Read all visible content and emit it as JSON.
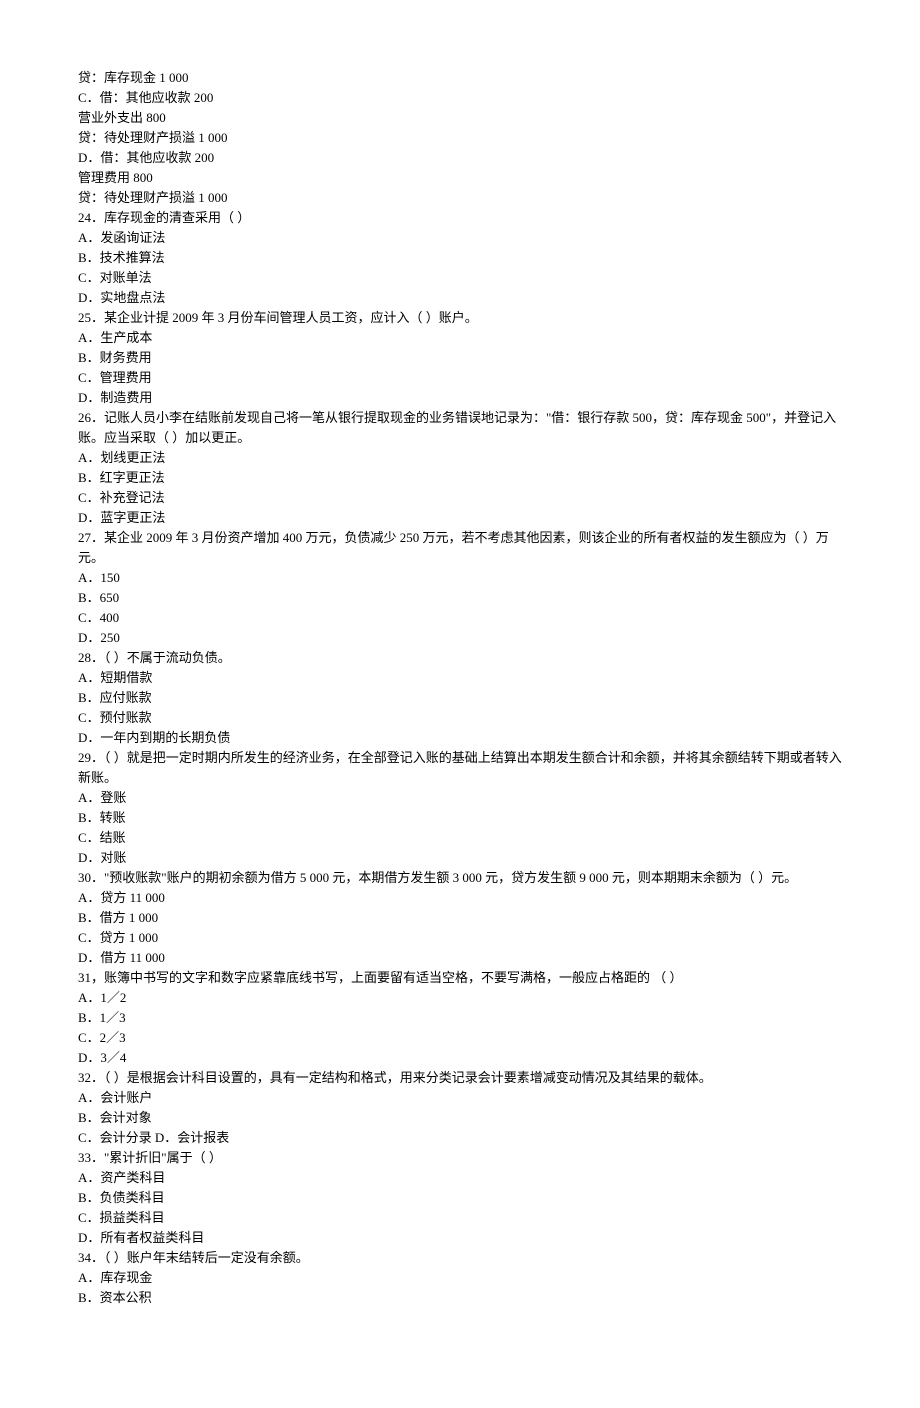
{
  "lines": [
    "贷：库存现金  1 000",
    "C．借：其他应收款  200",
    "营业外支出  800",
    "贷：待处理财产损溢  1 000",
    "D．借：其他应收款  200",
    "管理费用  800",
    "贷：待处理财产损溢  1 000",
    "24．库存现金的清查采用（    ）",
    "A．发函询证法",
    "B．技术推算法",
    "C．对账单法",
    "D．实地盘点法",
    "25．某企业计提 2009 年 3 月份车间管理人员工资，应计入（    ）账户。",
    "A．生产成本",
    "B．财务费用",
    "C．管理费用",
    "D．制造费用",
    "26．记账人员小李在结账前发现自己将一笔从银行提取现金的业务错误地记录为：\"借：银行存款 500，贷：库存现金 500\"，并登记入账。应当采取（    ）加以更正。",
    "A．划线更正法",
    "B．红字更正法",
    "C．补充登记法",
    "D．蓝字更正法",
    "27．某企业 2009 年 3 月份资产增加 400 万元，负债减少 250 万元，若不考虑其他因素，则该企业的所有者权益的发生额应为（    ）万元。",
    "A．150",
    "B．650",
    "C．400",
    "D．250",
    "28．（    ）不属于流动负债。",
    "A．短期借款",
    "B．应付账款",
    "C．预付账款",
    "D．一年内到期的长期负债",
    "29．（    ）就是把一定时期内所发生的经济业务，在全部登记入账的基础上结算出本期发生额合计和余额，并将其余额结转下期或者转入新账。",
    "A．登账",
    "B．转账",
    "C．结账",
    "D．对账",
    "30．\"预收账款\"账户的期初余额为借方 5 000 元，本期借方发生额 3 000 元，贷方发生额 9 000 元，则本期期末余额为（    ）元。",
    "A．贷方 11 000",
    "B．借方 1 000",
    "C．贷方 1 000",
    "D．借方 11 000",
    "31，账簿中书写的文字和数字应紧靠底线书写，上面要留有适当空格，不要写满格，一般应占格距的 （    ）",
    "A．1／2",
    "B．1／3",
    "C．2／3",
    "D．3／4",
    "32．（    ）是根据会计科目设置的，具有一定结构和格式，用来分类记录会计要素增减变动情况及其结果的载体。",
    "A．会计账户",
    "B．会计对象",
    "C．会计分录 D．会计报表",
    "33．\"累计折旧\"属于（    ）",
    "A．资产类科目",
    "B．负债类科目",
    "C．损益类科目",
    "D．所有者权益类科目",
    "34．（    ）账户年末结转后一定没有余额。",
    "A．库存现金",
    "B．资本公积"
  ]
}
